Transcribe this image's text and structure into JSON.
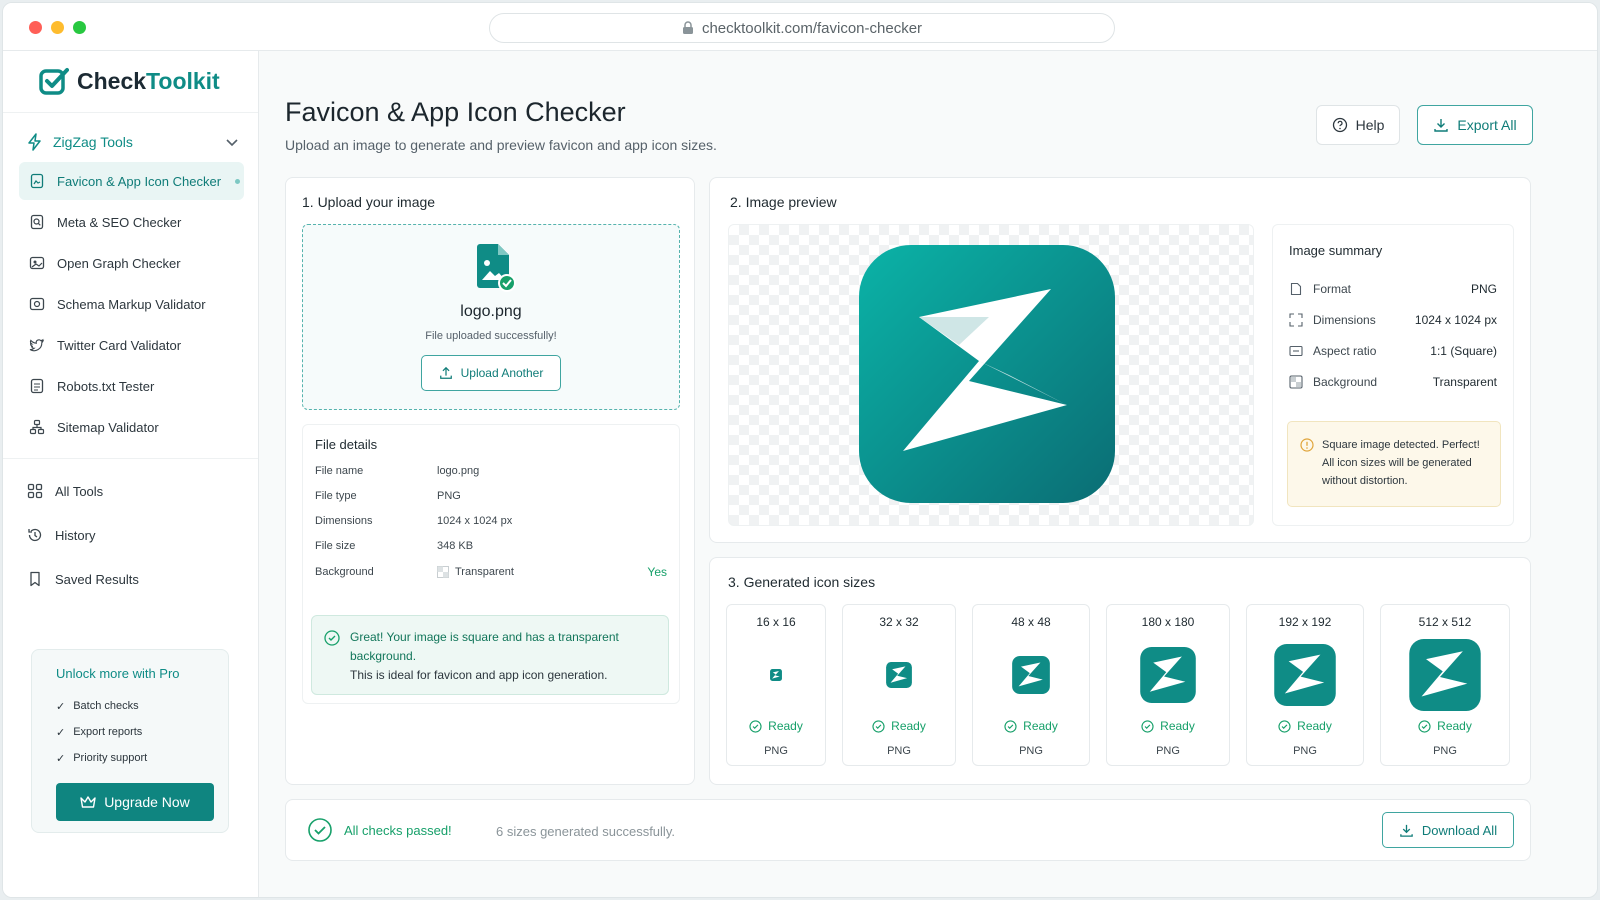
{
  "browser": {
    "url": "checktoolkit.com/favicon-checker"
  },
  "brand": {
    "name_part1": "Check",
    "name_part2": "Toolkit",
    "accent": "#0f8c86"
  },
  "sidebar": {
    "group_label": "ZigZag Tools",
    "items": [
      {
        "label": "Favicon & App Icon Checker",
        "icon": "favicon-file-icon",
        "active": true
      },
      {
        "label": "Meta & SEO Checker",
        "icon": "meta-search-icon"
      },
      {
        "label": "Open Graph Checker",
        "icon": "open-graph-icon"
      },
      {
        "label": "Schema Markup Validator",
        "icon": "schema-icon"
      },
      {
        "label": "Twitter Card Validator",
        "icon": "twitter-icon"
      },
      {
        "label": "Robots.txt Tester",
        "icon": "robots-file-icon"
      },
      {
        "label": "Sitemap Validator",
        "icon": "sitemap-icon"
      }
    ],
    "secondary": [
      {
        "label": "All Tools",
        "icon": "grid-icon"
      },
      {
        "label": "History",
        "icon": "history-icon"
      },
      {
        "label": "Saved Results",
        "icon": "bookmark-icon"
      }
    ],
    "pro": {
      "title": "Unlock more with Pro",
      "features": [
        "Batch checks",
        "Export reports",
        "Priority support"
      ],
      "button": "Upgrade Now"
    }
  },
  "header": {
    "title": "Favicon & App Icon Checker",
    "subtitle": "Upload an image to generate and preview favicon and app icon sizes.",
    "help": "Help",
    "export": "Export All"
  },
  "upload": {
    "section_title": "1. Upload your image",
    "file_name": "logo.png",
    "status": "File uploaded successfully!",
    "button": "Upload Another"
  },
  "file_details": {
    "title": "File details",
    "rows": [
      {
        "key": "File name",
        "value": "logo.png"
      },
      {
        "key": "File type",
        "value": "PNG"
      },
      {
        "key": "Dimensions",
        "value": "1024 x 1024 px"
      },
      {
        "key": "File size",
        "value": "348 KB"
      },
      {
        "key": "Background",
        "value": "Transparent",
        "flag": "Yes"
      }
    ],
    "success_line1": "Great! Your image is square and has a transparent background.",
    "success_line2": "This is ideal for favicon and app icon generation."
  },
  "preview": {
    "section_title": "2. Image preview",
    "summary_title": "Image summary",
    "summary": [
      {
        "key": "Format",
        "value": "PNG",
        "icon": "file-icon"
      },
      {
        "key": "Dimensions",
        "value": "1024 x 1024 px",
        "icon": "expand-icon"
      },
      {
        "key": "Aspect ratio",
        "value": "1:1 (Square)",
        "icon": "ratio-icon"
      },
      {
        "key": "Background",
        "value": "Transparent",
        "icon": "transparency-icon"
      }
    ],
    "notice_line1": "Square image detected. Perfect!",
    "notice_line2": "All icon sizes will be generated without distortion."
  },
  "sizes": {
    "section_title": "3. Generated icon sizes",
    "items": [
      {
        "size": "16 x 16",
        "status": "Ready",
        "format": "PNG"
      },
      {
        "size": "32 x 32",
        "status": "Ready",
        "format": "PNG"
      },
      {
        "size": "48 x 48",
        "status": "Ready",
        "format": "PNG"
      },
      {
        "size": "180 x 180",
        "status": "Ready",
        "format": "PNG"
      },
      {
        "size": "192 x 192",
        "status": "Ready",
        "format": "PNG"
      },
      {
        "size": "512 x 512",
        "status": "Ready",
        "format": "PNG"
      }
    ]
  },
  "footer": {
    "status": "All checks passed!",
    "detail": "6 sizes generated successfully.",
    "download": "Download All"
  }
}
